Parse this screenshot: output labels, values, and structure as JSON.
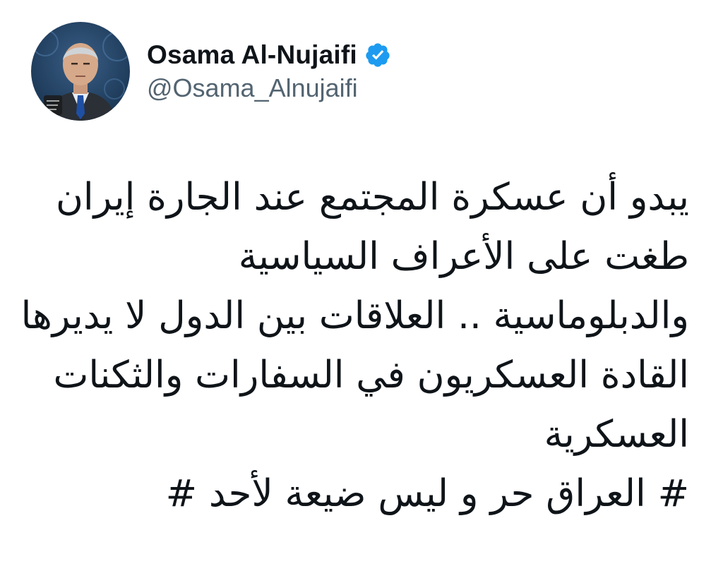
{
  "tweet": {
    "author": {
      "display_name": "Osama Al-Nujaifi",
      "handle": "@Osama_Alnujaifi",
      "verified": true,
      "verified_badge_color": "#1d9bf0"
    },
    "text_lines": [
      "يبدو أن عسكرة المجتمع عند الجارة إيران",
      "طغت على الأعراف السياسية",
      "والدبلوماسية .. العلاقات بين الدول لا يديرها",
      "القادة العسكريون في السفارات والثكنات",
      "العسكرية",
      "# العراق حر و ليس ضيعة لأحد  #"
    ]
  },
  "colors": {
    "text_primary": "#0f1419",
    "text_secondary": "#536471",
    "background": "#ffffff"
  },
  "icons": {
    "avatar": "profile-photo",
    "verified": "verified-badge-icon"
  }
}
